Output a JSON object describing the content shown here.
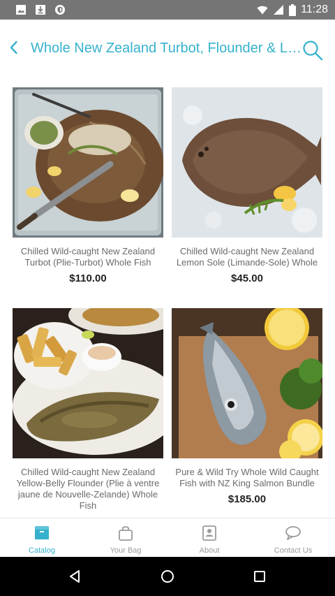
{
  "status_bar": {
    "time": "11:28",
    "left_icons": [
      "image-icon",
      "download-icon",
      "shield-icon"
    ],
    "right_icons": [
      "wifi-icon",
      "signal-icon",
      "battery-icon"
    ]
  },
  "header": {
    "title": "Whole New Zealand Turbot, Flounder & Lemon Sole",
    "back_icon": "chevron-left-icon",
    "search_icon": "search-icon",
    "accent_color": "#36b1cd"
  },
  "products": [
    {
      "name": "Chilled Wild-caught New Zealand Turbot (Plie-Turbot) Whole Fish",
      "price": "$110.00"
    },
    {
      "name": "Chilled Wild-caught New Zealand Lemon Sole (Limande-Sole) Whole",
      "price": "$45.00"
    },
    {
      "name": "Chilled Wild-caught New Zealand Yellow-Belly Flounder (Plie à ventre jaune de Nouvelle-Zelande) Whole Fish",
      "price": ""
    },
    {
      "name": "Pure & Wild Try Whole Wild Caught Fish with NZ King Salmon Bundle",
      "price": "$185.00"
    }
  ],
  "bottom_nav": {
    "active": "catalog",
    "items": [
      {
        "label": "Catalog",
        "icon": "catalog-icon"
      },
      {
        "label": "Your Bag",
        "icon": "bag-icon"
      },
      {
        "label": "About",
        "icon": "about-icon"
      },
      {
        "label": "Contact Us",
        "icon": "chat-icon"
      }
    ]
  },
  "system_nav": {
    "icons": [
      "back-triangle-icon",
      "home-circle-icon",
      "recents-square-icon"
    ]
  }
}
